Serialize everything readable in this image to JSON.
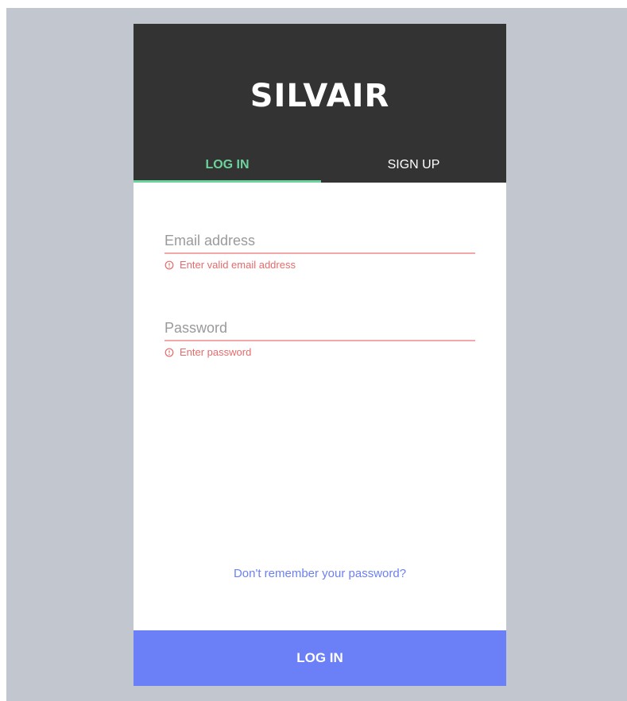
{
  "app": {
    "logo_text": "SILVAIR"
  },
  "tabs": [
    {
      "label": "LOG IN",
      "active": true
    },
    {
      "label": "SIGN UP",
      "active": false
    }
  ],
  "form": {
    "email": {
      "placeholder": "Email address",
      "value": "",
      "error": "Enter valid email address"
    },
    "password": {
      "placeholder": "Password",
      "value": "",
      "error": "Enter password"
    }
  },
  "forgot_password_link": "Don't remember your password?",
  "submit_button": "LOG IN",
  "icons": {
    "error": "alert-circle-icon"
  },
  "colors": {
    "header_bg": "#333333",
    "accent_green": "#6bd39b",
    "primary_blue": "#6b7ff7",
    "error_red": "#e86a6a",
    "backdrop": "#c2c6ce"
  }
}
